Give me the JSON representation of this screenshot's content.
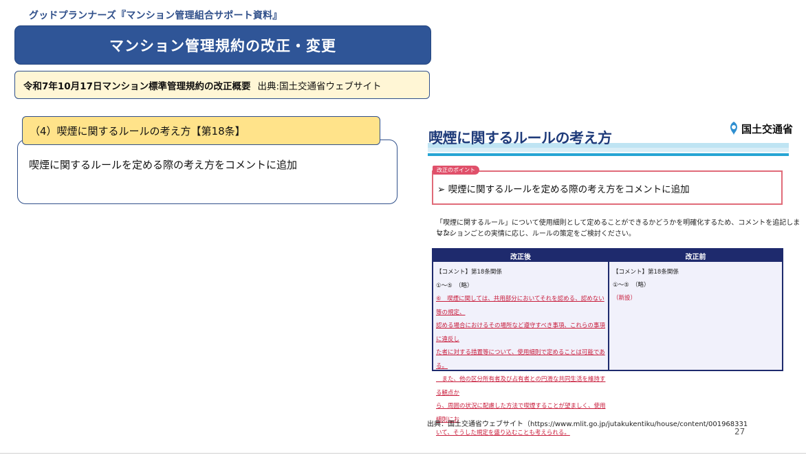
{
  "header": {
    "kicker": "グッドプランナーズ『マンション管理組合サポート資料』",
    "title": "マンション管理規約の改正・変更"
  },
  "source": {
    "summary": "令和7年10月17日マンション標準管理規約の改正概要",
    "credit": "出典:国土交通省ウェブサイト"
  },
  "section": {
    "heading": "（4）喫煙に関するルールの考え方【第18条】",
    "body": "喫煙に関するルールを定める際の考え方をコメントに追加"
  },
  "embedded_slide": {
    "title": "喫煙に関するルールの考え方",
    "logo_text": "国土交通省",
    "point_tag": "改正のポイント",
    "point_text": "喫煙に関するルールを定める際の考え方をコメントに追加",
    "description_line1": "「喫煙に関するルール」について使用細則として定めることができるかどうかを明確化するため、コメントを追記しました。",
    "description_line2": "マンションごとの実情に応じ、ルールの策定をご検討ください。",
    "table": {
      "header_after": "改正後",
      "header_before": "改正前",
      "after_line1": "【コメント】第18条関係",
      "after_line2": "①～⑤　（略）",
      "after_red1": "⑥　喫煙に関しては、共用部分においてそれを認める、認めない等の規定、",
      "after_red2": "認める場合におけるその場所など遵守すべき事項、これらの事項に違反し",
      "after_red3": "た者に対する措置等について、使用細則で定めることは可能である。",
      "after_red4": "　また、他の区分所有者及び占有者との円滑な共同生活を維持する観点か",
      "after_red5": "ら、周囲の状況に配慮した方法で喫煙することが望ましく、使用細則にお",
      "after_red6": "いて、そうした規定を盛り込むことも考えられる。",
      "before_line1": "【コメント】第18条関係",
      "before_line2": "①～⑤　（略）",
      "before_line3": "（新設）"
    }
  },
  "footer": {
    "source_url": "出典：国土交通省ウェブサイト（https://www.mlit.go.jp/jutakukentiku/house/content/001968331",
    "page_number": "27"
  },
  "colors": {
    "banner": "#2f5597",
    "tab": "#ffe38a",
    "source_bg": "#fff6d5",
    "table_header": "#1e2a6d",
    "accent_red": "#c81b3a"
  }
}
